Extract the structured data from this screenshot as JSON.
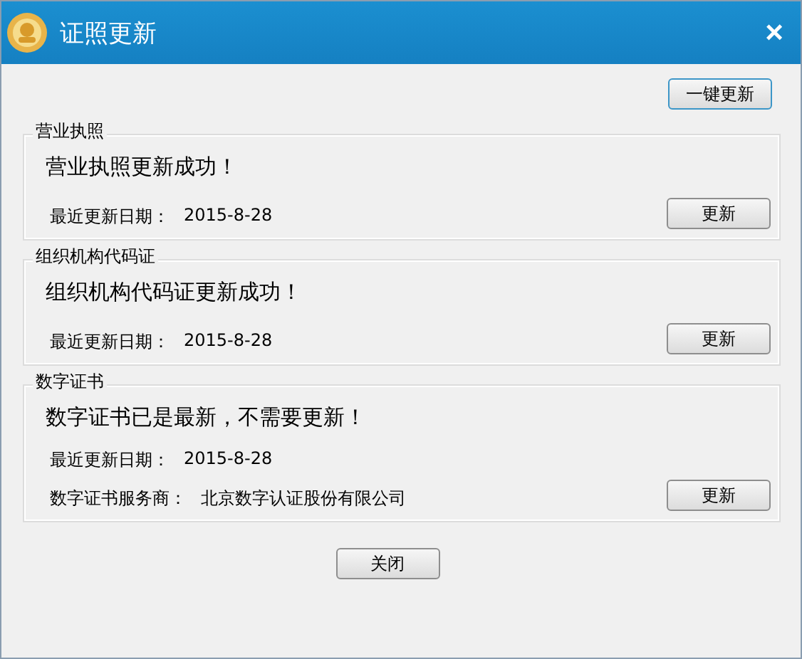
{
  "window": {
    "title": "证照更新",
    "close": "×"
  },
  "update_all_button": "一键更新",
  "groups": [
    {
      "title": "营业执照",
      "message": "营业执照更新成功！",
      "details": [
        {
          "label": "最近更新日期：",
          "value": "2015-8-28"
        }
      ],
      "button": "更新"
    },
    {
      "title": "组织机构代码证",
      "message": "组织机构代码证更新成功！",
      "details": [
        {
          "label": "最近更新日期：",
          "value": "2015-8-28"
        }
      ],
      "button": "更新"
    },
    {
      "title": "数字证书",
      "message": "数字证书已是最新，不需要更新！",
      "details": [
        {
          "label": "最近更新日期：",
          "value": "2015-8-28"
        },
        {
          "label": "数字证书服务商：",
          "value": "北京数字认证股份有限公司"
        }
      ],
      "button": "更新"
    }
  ],
  "close_button": "关闭"
}
